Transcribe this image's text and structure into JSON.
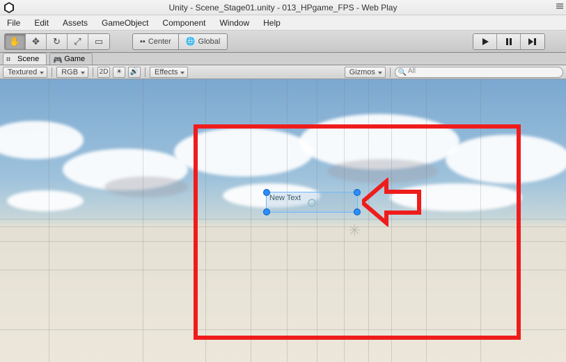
{
  "titlebar": {
    "text": "Unity - Scene_Stage01.unity - 013_HPgame_FPS - Web Play"
  },
  "menubar": {
    "items": [
      "File",
      "Edit",
      "Assets",
      "GameObject",
      "Component",
      "Window",
      "Help"
    ]
  },
  "toolbar": {
    "pivot_center": "Center",
    "pivot_global": "Global"
  },
  "tabs": {
    "scene": "Scene",
    "game": "Game"
  },
  "scene_toolbar": {
    "shading": "Textured",
    "render_mode": "RGB",
    "toggle_2d": "2D",
    "effects_label": "Effects",
    "gizmos_label": "Gizmos",
    "search_placeholder": "All"
  },
  "scene_object": {
    "text_label": "New Text"
  }
}
